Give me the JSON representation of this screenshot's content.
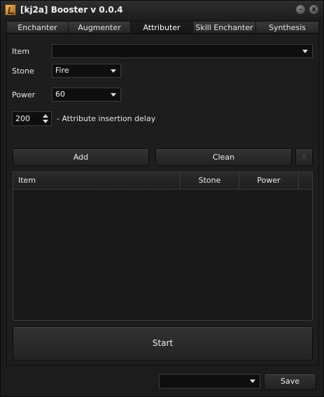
{
  "window": {
    "title": "[kj2a] Booster v 0.0.4",
    "minimize_glyph": "–",
    "close_glyph": "x"
  },
  "tabs": [
    {
      "label": "Enchanter",
      "active": false
    },
    {
      "label": "Augmenter",
      "active": false
    },
    {
      "label": "Attributer",
      "active": true
    },
    {
      "label": "Skill Enchanter",
      "active": false
    },
    {
      "label": "Synthesis",
      "active": false
    }
  ],
  "form": {
    "item_label": "Item",
    "item_value": "",
    "stone_label": "Stone",
    "stone_value": "Fire",
    "power_label": "Power",
    "power_value": "60",
    "delay_value": "200",
    "delay_label": "- Attribute insertion delay"
  },
  "buttons": {
    "add": "Add",
    "clean": "Clean",
    "remove": "X",
    "start": "Start",
    "save": "Save"
  },
  "table": {
    "columns": [
      "Item",
      "Stone",
      "Power"
    ],
    "rows": []
  },
  "footer": {
    "profile_value": ""
  },
  "colors": {
    "background": "#1c1c1c",
    "field": "#0e0e0e",
    "text": "#e8e8e8"
  },
  "icons": {
    "app": "booster-app-icon",
    "dropdown": "chevron-down-icon",
    "spin": "spin-arrows-icon"
  }
}
